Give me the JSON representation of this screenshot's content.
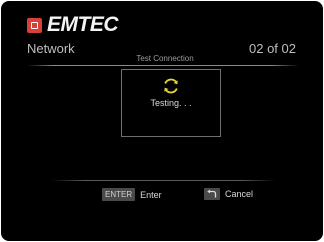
{
  "brand": {
    "logo_text": "EMTEC",
    "badge_color": "#d8403a"
  },
  "header": {
    "page_name": "Network",
    "page_counter": "02 of 02"
  },
  "dialog": {
    "title": "Test Connection",
    "status_text": "Testing. . .",
    "spinner_icon": "refresh-spinner-icon",
    "spinner_color": "#e8d23a"
  },
  "footer": {
    "enter_key": "ENTER",
    "enter_label": "Enter",
    "back_icon": "return-arrow-icon",
    "cancel_label": "Cancel"
  }
}
